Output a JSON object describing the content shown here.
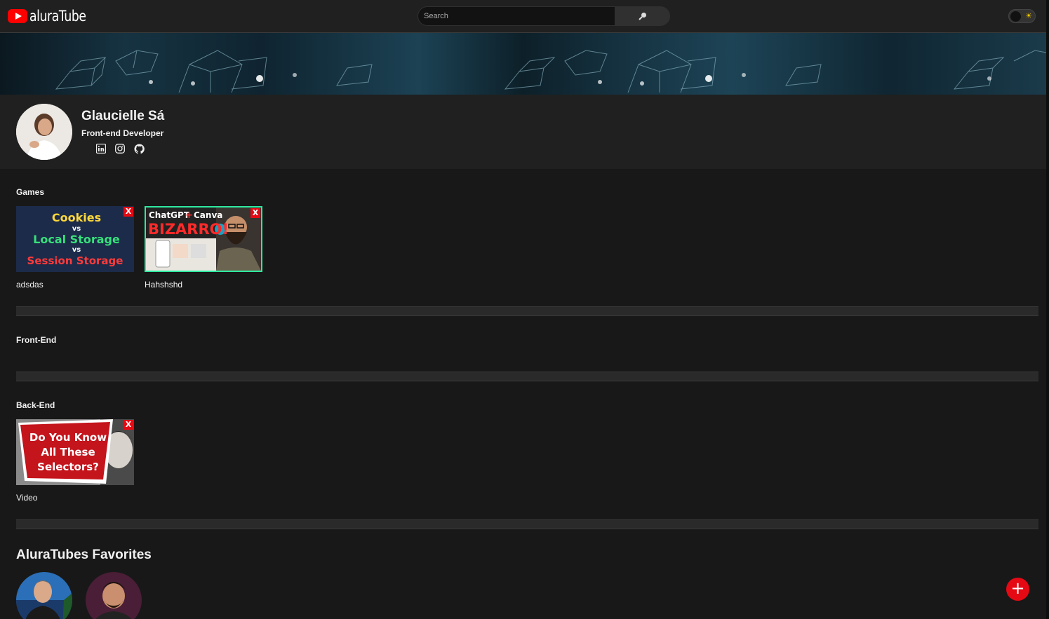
{
  "header": {
    "logo_text": "aluraTube",
    "search_placeholder": "Search",
    "icons": {
      "search": "search-icon",
      "theme": "sun-icon"
    }
  },
  "profile": {
    "name": "Glaucielle Sá",
    "job": "Front-end Developer",
    "socials": [
      "linkedin-icon",
      "instagram-icon",
      "github-icon"
    ]
  },
  "sections": [
    {
      "title": "Games",
      "videos": [
        {
          "title": "adsdas",
          "thumb_text": [
            "Cookies",
            "vs",
            "Local Storage",
            "vs",
            "Session Storage"
          ],
          "remove_label": "X"
        },
        {
          "title": "Hahshshd",
          "thumb_text": [
            "ChatGPT",
            "Canva",
            "BIZARRO!"
          ],
          "remove_label": "X"
        }
      ]
    },
    {
      "title": "Front-End",
      "videos": []
    },
    {
      "title": "Back-End",
      "videos": [
        {
          "title": "Video",
          "thumb_text": [
            "Do You Know",
            "All These",
            "Selectors?"
          ],
          "remove_label": "X"
        }
      ]
    }
  ],
  "favorites": {
    "title": "AluraTubes Favorites",
    "items": [
      "favorite-avatar-1",
      "favorite-avatar-2"
    ]
  },
  "fab": {
    "label": "+"
  },
  "colors": {
    "accent": "#e50914",
    "background": "#181818",
    "header": "#202020"
  }
}
